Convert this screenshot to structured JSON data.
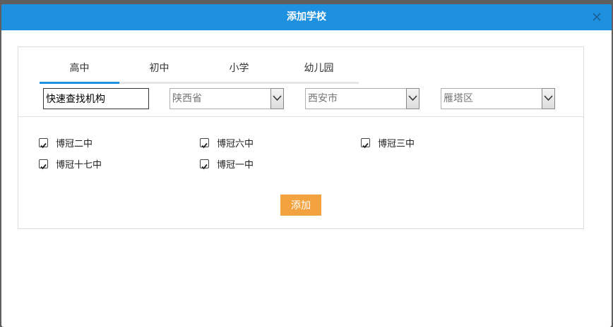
{
  "dialog": {
    "title": "添加学校",
    "close_icon": "close-icon"
  },
  "tabs": [
    {
      "label": "高中",
      "active": true
    },
    {
      "label": "初中",
      "active": false
    },
    {
      "label": "小学",
      "active": false
    },
    {
      "label": "幼儿园",
      "active": false
    }
  ],
  "search": {
    "value": "快速查找机构"
  },
  "filters": {
    "province": "陕西省",
    "city": "西安市",
    "district": "雁塔区"
  },
  "schools": [
    {
      "name": "博冠二中",
      "checked": true
    },
    {
      "name": "博冠六中",
      "checked": true
    },
    {
      "name": "博冠三中",
      "checked": true
    },
    {
      "name": "博冠十七中",
      "checked": true
    },
    {
      "name": "博冠一中",
      "checked": true
    }
  ],
  "actions": {
    "add_label": "添加"
  },
  "colors": {
    "titlebar": "#1e90e0",
    "accent": "#1e90e0",
    "add_button": "#f2a23f"
  }
}
